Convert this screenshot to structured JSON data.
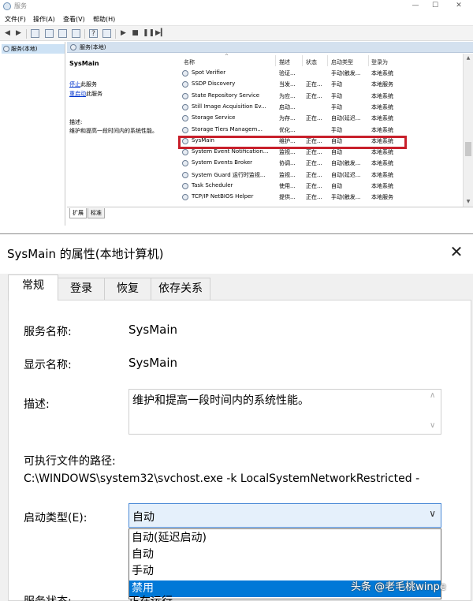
{
  "services_window": {
    "title": "服务",
    "menu": [
      "文件(F)",
      "操作(A)",
      "查看(V)",
      "帮助(H)"
    ],
    "tree_item": "服务(本地)",
    "header_label": "服务(本地)",
    "detail": {
      "service_name": "SysMain",
      "stop_link": "停止",
      "stop_suffix": "此服务",
      "restart_link": "重启动",
      "restart_suffix": "此服务",
      "desc_label": "描述:",
      "desc_text": "维护和提高一段时间内的系统性能。"
    },
    "columns": [
      "名称",
      "描述",
      "状态",
      "启动类型",
      "登录为"
    ],
    "rows": [
      {
        "name": "Spot Verifier",
        "desc": "验证...",
        "state": "",
        "start": "手动(触发...",
        "logon": "本地系统"
      },
      {
        "name": "SSDP Discovery",
        "desc": "当发...",
        "state": "正在...",
        "start": "手动",
        "logon": "本地服务"
      },
      {
        "name": "State Repository Service",
        "desc": "为应...",
        "state": "正在...",
        "start": "手动",
        "logon": "本地系统"
      },
      {
        "name": "Still Image Acquisition Ev...",
        "desc": "启动...",
        "state": "",
        "start": "手动",
        "logon": "本地系统"
      },
      {
        "name": "Storage Service",
        "desc": "为存...",
        "state": "正在...",
        "start": "自动(延迟...",
        "logon": "本地系统"
      },
      {
        "name": "Storage Tiers Managem...",
        "desc": "优化...",
        "state": "",
        "start": "手动",
        "logon": "本地系统"
      },
      {
        "name": "SysMain",
        "desc": "维护...",
        "state": "正在...",
        "start": "自动",
        "logon": "本地系统"
      },
      {
        "name": "System Event Notification...",
        "desc": "监视...",
        "state": "正在...",
        "start": "自动",
        "logon": "本地系统"
      },
      {
        "name": "System Events Broker",
        "desc": "协调...",
        "state": "正在...",
        "start": "自动(触发...",
        "logon": "本地系统"
      },
      {
        "name": "System Guard 运行时监视...",
        "desc": "监视...",
        "state": "正在...",
        "start": "自动(延迟...",
        "logon": "本地系统"
      },
      {
        "name": "Task Scheduler",
        "desc": "使用...",
        "state": "正在...",
        "start": "自动",
        "logon": "本地系统"
      },
      {
        "name": "TCP/IP NetBIOS Helper",
        "desc": "提供...",
        "state": "正在...",
        "start": "手动(触发...",
        "logon": "本地服务"
      }
    ],
    "bottom_tabs": [
      "扩展",
      "标准"
    ]
  },
  "properties_dialog": {
    "title": "SysMain 的属性(本地计算机)",
    "close": "✕",
    "tabs": [
      "常规",
      "登录",
      "恢复",
      "依存关系"
    ],
    "service_name_label": "服务名称:",
    "service_name_value": "SysMain",
    "display_name_label": "显示名称:",
    "display_name_value": "SysMain",
    "description_label": "描述:",
    "description_value": "维护和提高一段时间内的系统性能。",
    "path_label": "可执行文件的路径:",
    "path_value": "C:\\WINDOWS\\system32\\svchost.exe -k LocalSystemNetworkRestricted -",
    "startup_label": "启动类型(E):",
    "startup_selected": "自动",
    "startup_options": [
      "自动(延迟启动)",
      "自动",
      "手动",
      "禁用"
    ],
    "status_label": "服务状态:",
    "status_value": "正在运行"
  },
  "watermark": "头条 @老毛桃winpe",
  "colors": {
    "highlight_box": "#c8202b",
    "dropdown_selection": "#0078d7",
    "combo_border": "#4c8ad6"
  }
}
